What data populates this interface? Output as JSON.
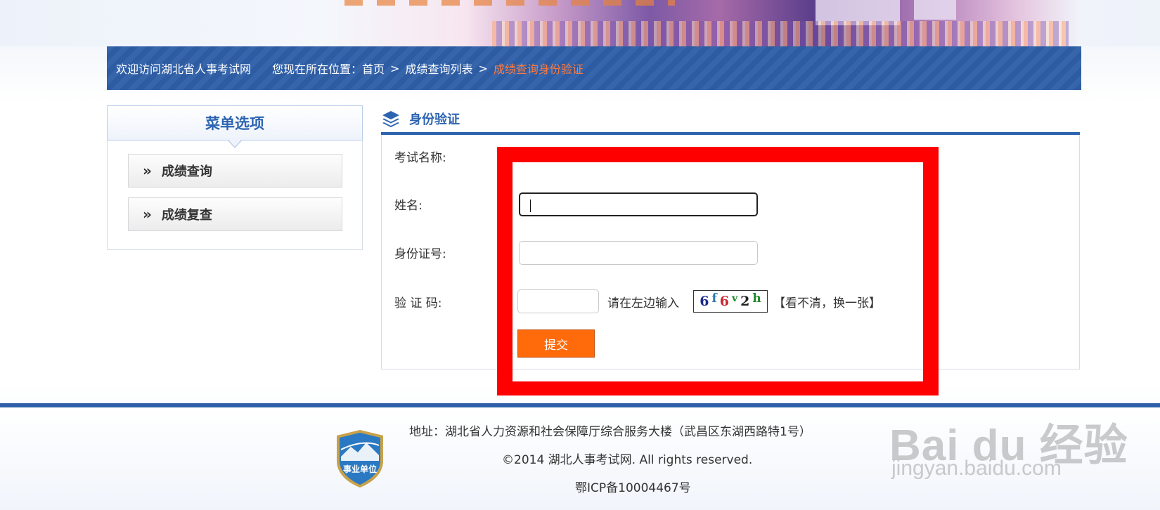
{
  "nav": {
    "welcome": "欢迎访问湖北省人事考试网",
    "location_prefix": "您现在所在位置：",
    "crumb_home": "首页",
    "crumb_list": "成绩查询列表",
    "crumb_current": "成绩查询身份验证",
    "separator": ">"
  },
  "menu": {
    "title": "菜单选项",
    "items": [
      {
        "label": "成绩查询"
      },
      {
        "label": "成绩复查"
      }
    ],
    "chevron": "»"
  },
  "content": {
    "title": "身份验证",
    "exam_name_label": "考试名称:",
    "name_label": "姓名:",
    "id_label": "身份证号:",
    "captcha_label": "验 证 码:",
    "captcha_hint": "请在左边输入",
    "captcha_chars": [
      "6",
      "f",
      "6",
      "v",
      "2",
      "h"
    ],
    "refresh_text": "【看不清，换一张】",
    "submit_label": "提交"
  },
  "footer": {
    "address": "地址：湖北省人力资源和社会保障厅综合服务大楼（武昌区东湖西路特1号）",
    "copyright": "©2014 湖北人事考试网. All rights reserved.",
    "icp": "鄂ICP备10004467号",
    "badge_text": "事业单位"
  },
  "watermark": {
    "brand": "Bai  du 经验",
    "url": "jingyan.baidu.com"
  },
  "colors": {
    "nav_bg": "#2e5fa8",
    "accent_blue": "#2d64b0",
    "breadcrumb_current": "#ff7a3d",
    "submit_bg": "#ff6a0b",
    "highlight_frame": "#ff0000"
  }
}
